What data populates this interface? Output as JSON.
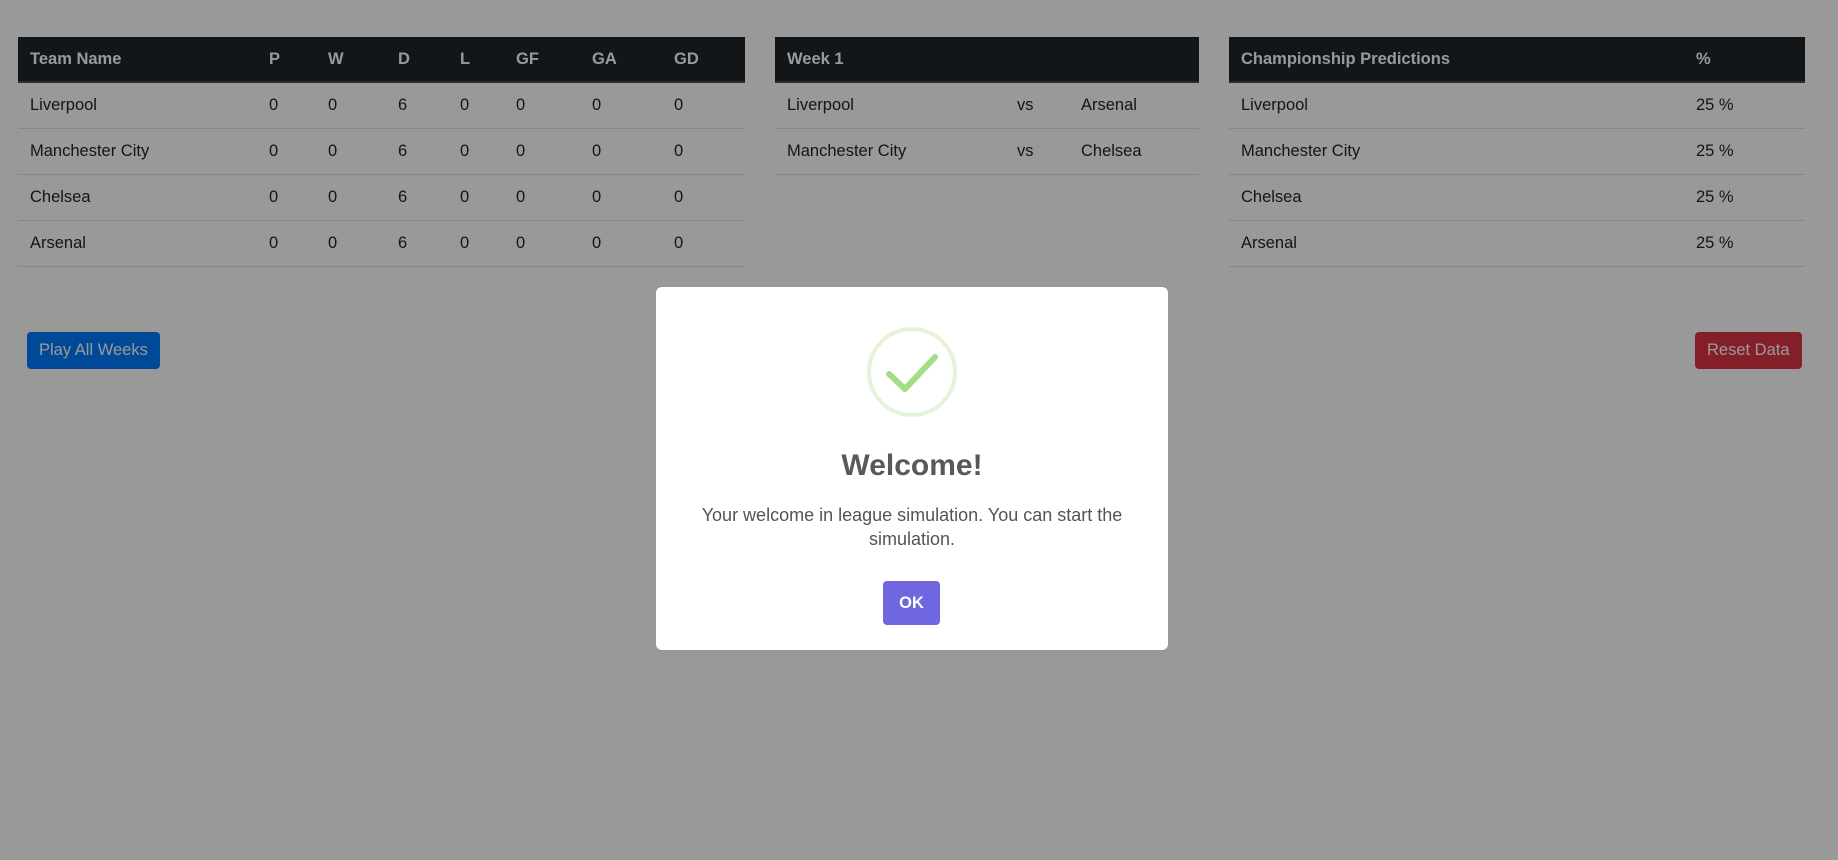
{
  "standings": {
    "headers": [
      "Team Name",
      "P",
      "W",
      "D",
      "L",
      "GF",
      "GA",
      "GD"
    ],
    "rows": [
      [
        "Liverpool",
        "0",
        "0",
        "6",
        "0",
        "0",
        "0",
        "0"
      ],
      [
        "Manchester City",
        "0",
        "0",
        "6",
        "0",
        "0",
        "0",
        "0"
      ],
      [
        "Chelsea",
        "0",
        "0",
        "6",
        "0",
        "0",
        "0",
        "0"
      ],
      [
        "Arsenal",
        "0",
        "0",
        "6",
        "0",
        "0",
        "0",
        "0"
      ]
    ]
  },
  "fixtures": {
    "title": "Week 1",
    "matches": [
      {
        "home": "Liverpool",
        "vs": "vs",
        "away": "Arsenal"
      },
      {
        "home": "Manchester City",
        "vs": "vs",
        "away": "Chelsea"
      }
    ]
  },
  "predictions": {
    "headers": [
      "Championship Predictions",
      "%"
    ],
    "rows": [
      [
        "Liverpool",
        "25 %"
      ],
      [
        "Manchester City",
        "25 %"
      ],
      [
        "Chelsea",
        "25 %"
      ],
      [
        "Arsenal",
        "25 %"
      ]
    ]
  },
  "actions": {
    "play_all_label": "Play All Weeks",
    "reset_label": "Reset Data"
  },
  "modal": {
    "icon": "success-check-icon",
    "title": "Welcome!",
    "text": "Your welcome in league simulation. You can start the simulation.",
    "ok_label": "OK"
  },
  "colors": {
    "primary": "#007bff",
    "danger": "#dc3545",
    "confirm": "#7066e0",
    "table_header": "#212529",
    "success": "#a5dc86"
  }
}
